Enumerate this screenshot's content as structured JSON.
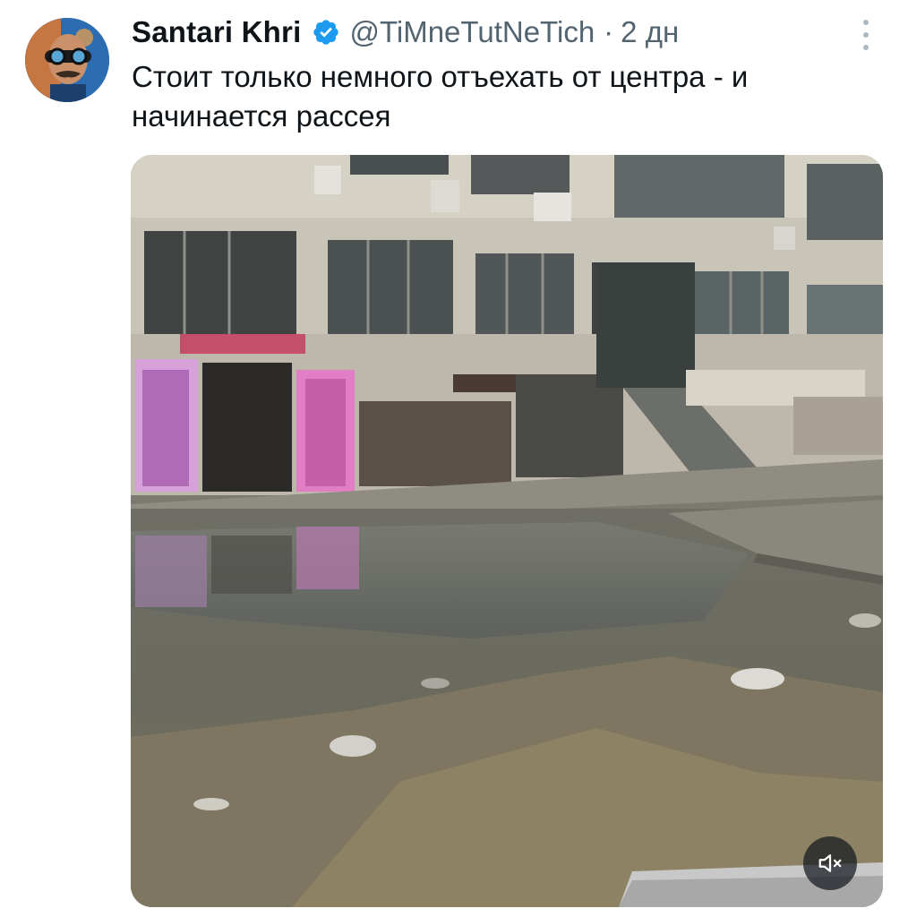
{
  "tweet": {
    "author_name": "Santari Khri",
    "handle": "@TiMneTutNeTich",
    "separator": "·",
    "time": "2 дн",
    "text": "Стоит только немного отъехать от центра - и начинается рассея",
    "verified": true
  },
  "icons": {
    "verified": "verified-badge-icon",
    "more": "more-vertical-icon",
    "mute": "volume-muted-icon"
  },
  "colors": {
    "text_primary": "#0f1419",
    "text_secondary": "#536471",
    "verified_blue": "#1d9bf0"
  }
}
